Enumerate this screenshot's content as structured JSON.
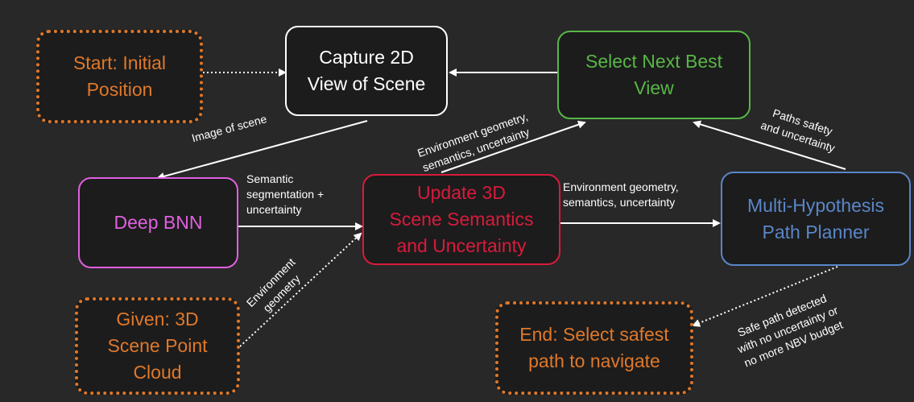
{
  "colors": {
    "background": "#282828",
    "node_fill": "#1c1c1c",
    "orange": "#e0782a",
    "white": "#ffffff",
    "green": "#58b646",
    "pink": "#e060e0",
    "red": "#d81b3c",
    "blue": "#5a86c8"
  },
  "nodes": {
    "start": "Start: Initial\nPosition",
    "capture": "Capture 2D\nView of Scene",
    "select_nbv": "Select Next Best\nView",
    "deep_bnn": "Deep BNN",
    "update": "Update 3D\nScene Semantics\nand Uncertainty",
    "planner": "Multi-Hypothesis\nPath Planner",
    "given": "Given: 3D\nScene Point\nCloud",
    "end": "End: Select safest\npath to navigate"
  },
  "edge_labels": {
    "image_of_scene": "Image of scene",
    "semantic_seg": "Semantic\nsegmentation +\nuncertainty",
    "env_geom_sem_unc_to_nbv": "Environment geometry,\nsemantics, uncertainty",
    "env_geom_sem_unc_to_planner": "Environment geometry,\nsemantics, uncertainty",
    "paths_safety": "Paths safety\nand uncertainty",
    "env_geometry": "Environment\ngeometry",
    "safe_path": "Safe path detected\nwith no uncertainty or\nno more NBV budget"
  }
}
